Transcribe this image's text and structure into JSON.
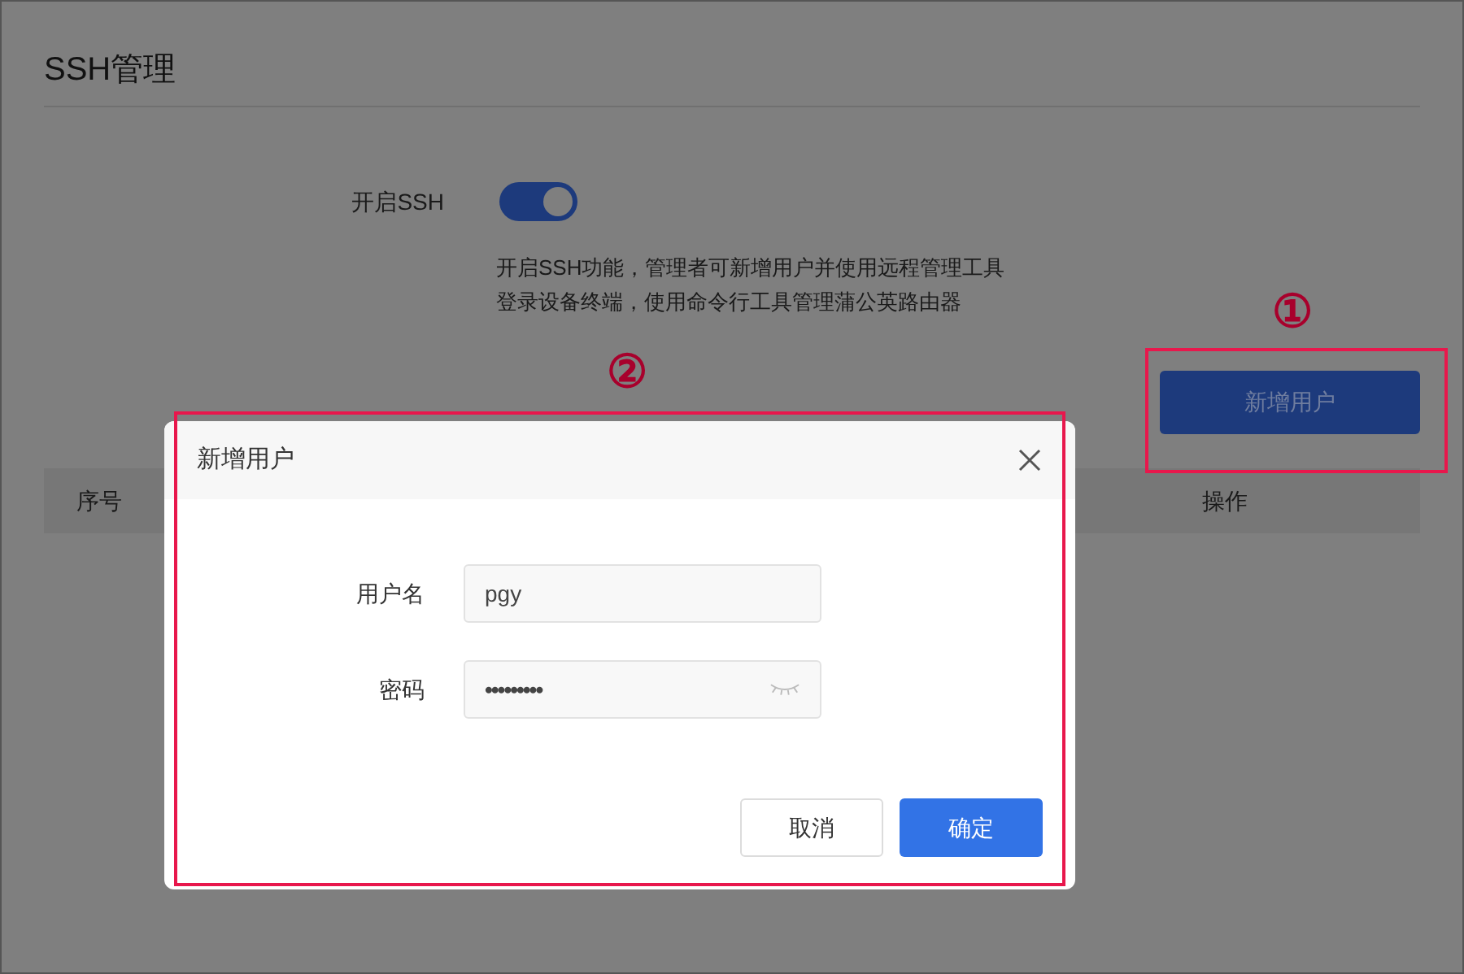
{
  "page": {
    "title": "SSH管理"
  },
  "ssh": {
    "label": "开启SSH",
    "on": true
  },
  "description": [
    "开启SSH功能，管理者可新增用户并使用远程管理工具",
    "登录设备终端，使用命令行工具管理蒲公英路由器"
  ],
  "add_user_button": "新增用户",
  "table": {
    "columns": [
      "序号",
      "操作"
    ]
  },
  "dialog": {
    "title": "新增用户",
    "fields": [
      {
        "label": "用户名",
        "value": "pgy",
        "kind": "text"
      },
      {
        "label": "密码",
        "value": "•••••••••",
        "kind": "password"
      }
    ],
    "buttons": [
      {
        "label": "取消",
        "kind": "secondary"
      },
      {
        "label": "确定",
        "kind": "primary"
      }
    ]
  },
  "annotations": [
    {
      "label": "①"
    },
    {
      "label": "②"
    }
  ]
}
